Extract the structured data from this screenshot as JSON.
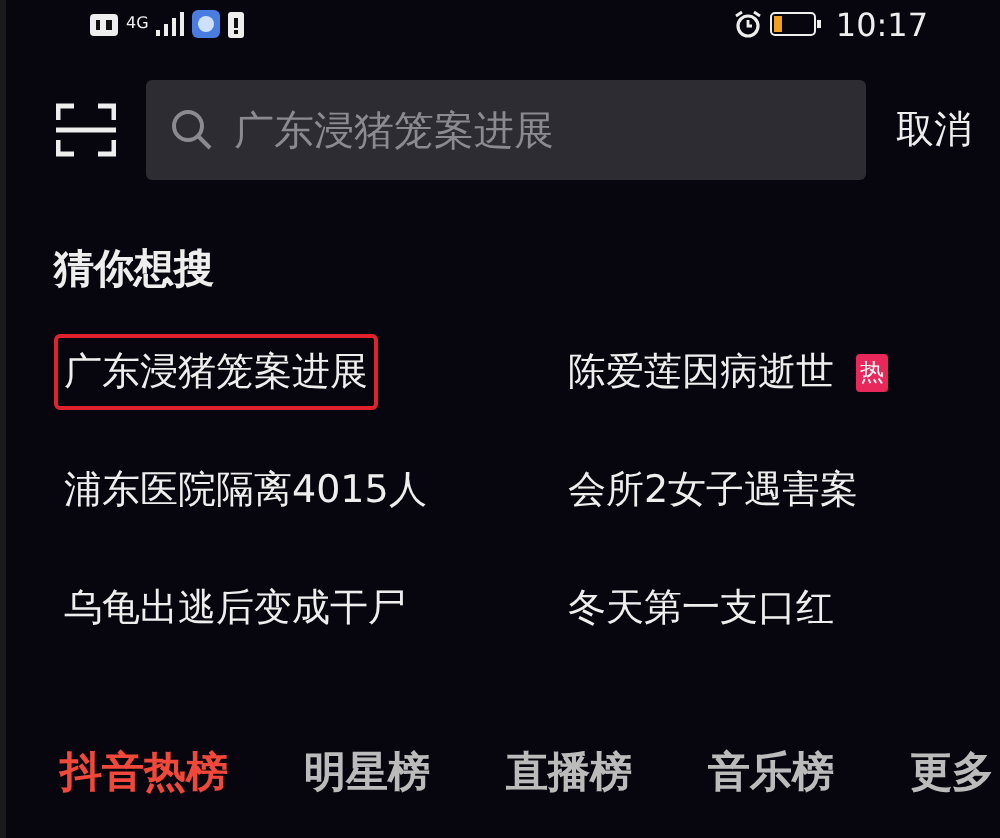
{
  "status_bar": {
    "network": "4G",
    "time": "10:17"
  },
  "search": {
    "placeholder": "广东浸猪笼案进展",
    "cancel": "取消"
  },
  "suggestions": {
    "title": "猜你想搜",
    "items": [
      {
        "text": "广东浸猪笼案进展",
        "highlighted": true
      },
      {
        "text": "陈爱莲因病逝世",
        "highlighted": false,
        "badge": "热"
      },
      {
        "text": "浦东医院隔离4015人",
        "highlighted": false
      },
      {
        "text": "会所2女子遇害案",
        "highlighted": false
      },
      {
        "text": "乌龟出逃后变成干尸",
        "highlighted": false
      },
      {
        "text": "冬天第一支口红",
        "highlighted": false
      }
    ]
  },
  "tabs": [
    {
      "label": "抖音热榜",
      "selected": true
    },
    {
      "label": "明星榜",
      "selected": false
    },
    {
      "label": "直播榜",
      "selected": false
    },
    {
      "label": "音乐榜",
      "selected": false
    },
    {
      "label": "更多",
      "selected": false
    }
  ]
}
